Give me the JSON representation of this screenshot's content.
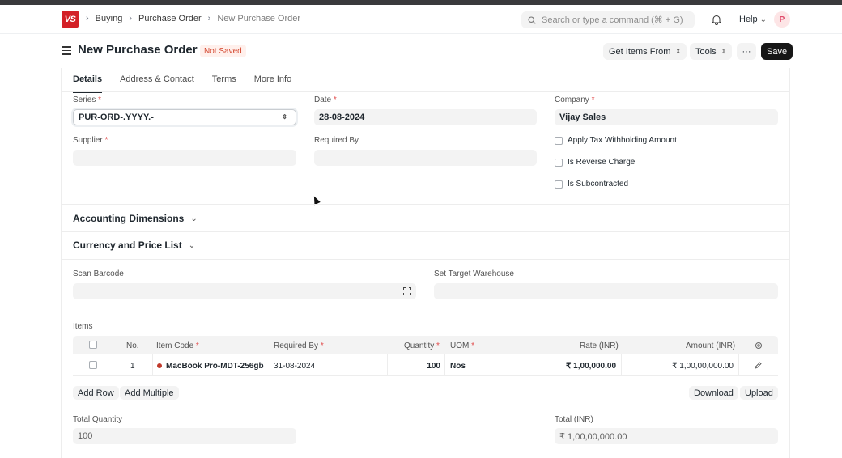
{
  "nav": {
    "logo": "VS",
    "breadcrumbs": [
      "Buying",
      "Purchase Order",
      "New Purchase Order"
    ],
    "search_placeholder": "Search or type a command (⌘ + G)",
    "help_label": "Help",
    "avatar_initial": "P"
  },
  "header": {
    "title": "New Purchase Order",
    "status": "Not Saved",
    "get_items_label": "Get Items From",
    "tools_label": "Tools",
    "more_label": "···",
    "save_label": "Save"
  },
  "tabs": [
    "Details",
    "Address & Contact",
    "Terms",
    "More Info"
  ],
  "form": {
    "series_label": "Series",
    "series_value": "PUR-ORD-.YYYY.-",
    "date_label": "Date",
    "date_value": "28-08-2024",
    "company_label": "Company",
    "company_value": "Vijay Sales",
    "supplier_label": "Supplier",
    "supplier_value": "",
    "required_by_label": "Required By",
    "required_by_value": "",
    "checks": [
      "Apply Tax Withholding Amount",
      "Is Reverse Charge",
      "Is Subcontracted"
    ]
  },
  "sections": {
    "accounting": "Accounting Dimensions",
    "currency": "Currency and Price List"
  },
  "scan": {
    "barcode_label": "Scan Barcode",
    "warehouse_label": "Set Target Warehouse"
  },
  "items": {
    "label": "Items",
    "columns": {
      "no": "No.",
      "item_code": "Item Code",
      "required_by": "Required By",
      "quantity": "Quantity",
      "uom": "UOM",
      "rate": "Rate (INR)",
      "amount": "Amount (INR)"
    },
    "rows": [
      {
        "no": "1",
        "item_code": "MacBook Pro-MDT-256gb",
        "required_by": "31-08-2024",
        "quantity": "100",
        "uom": "Nos",
        "rate": "₹ 1,00,000.00",
        "amount": "₹ 1,00,00,000.00"
      }
    ],
    "add_row": "Add Row",
    "add_multiple": "Add Multiple",
    "download": "Download",
    "upload": "Upload"
  },
  "totals": {
    "total_quantity_label": "Total Quantity",
    "total_quantity_value": "100",
    "total_label": "Total (INR)",
    "total_value": "₹ 1,00,00,000.00"
  }
}
